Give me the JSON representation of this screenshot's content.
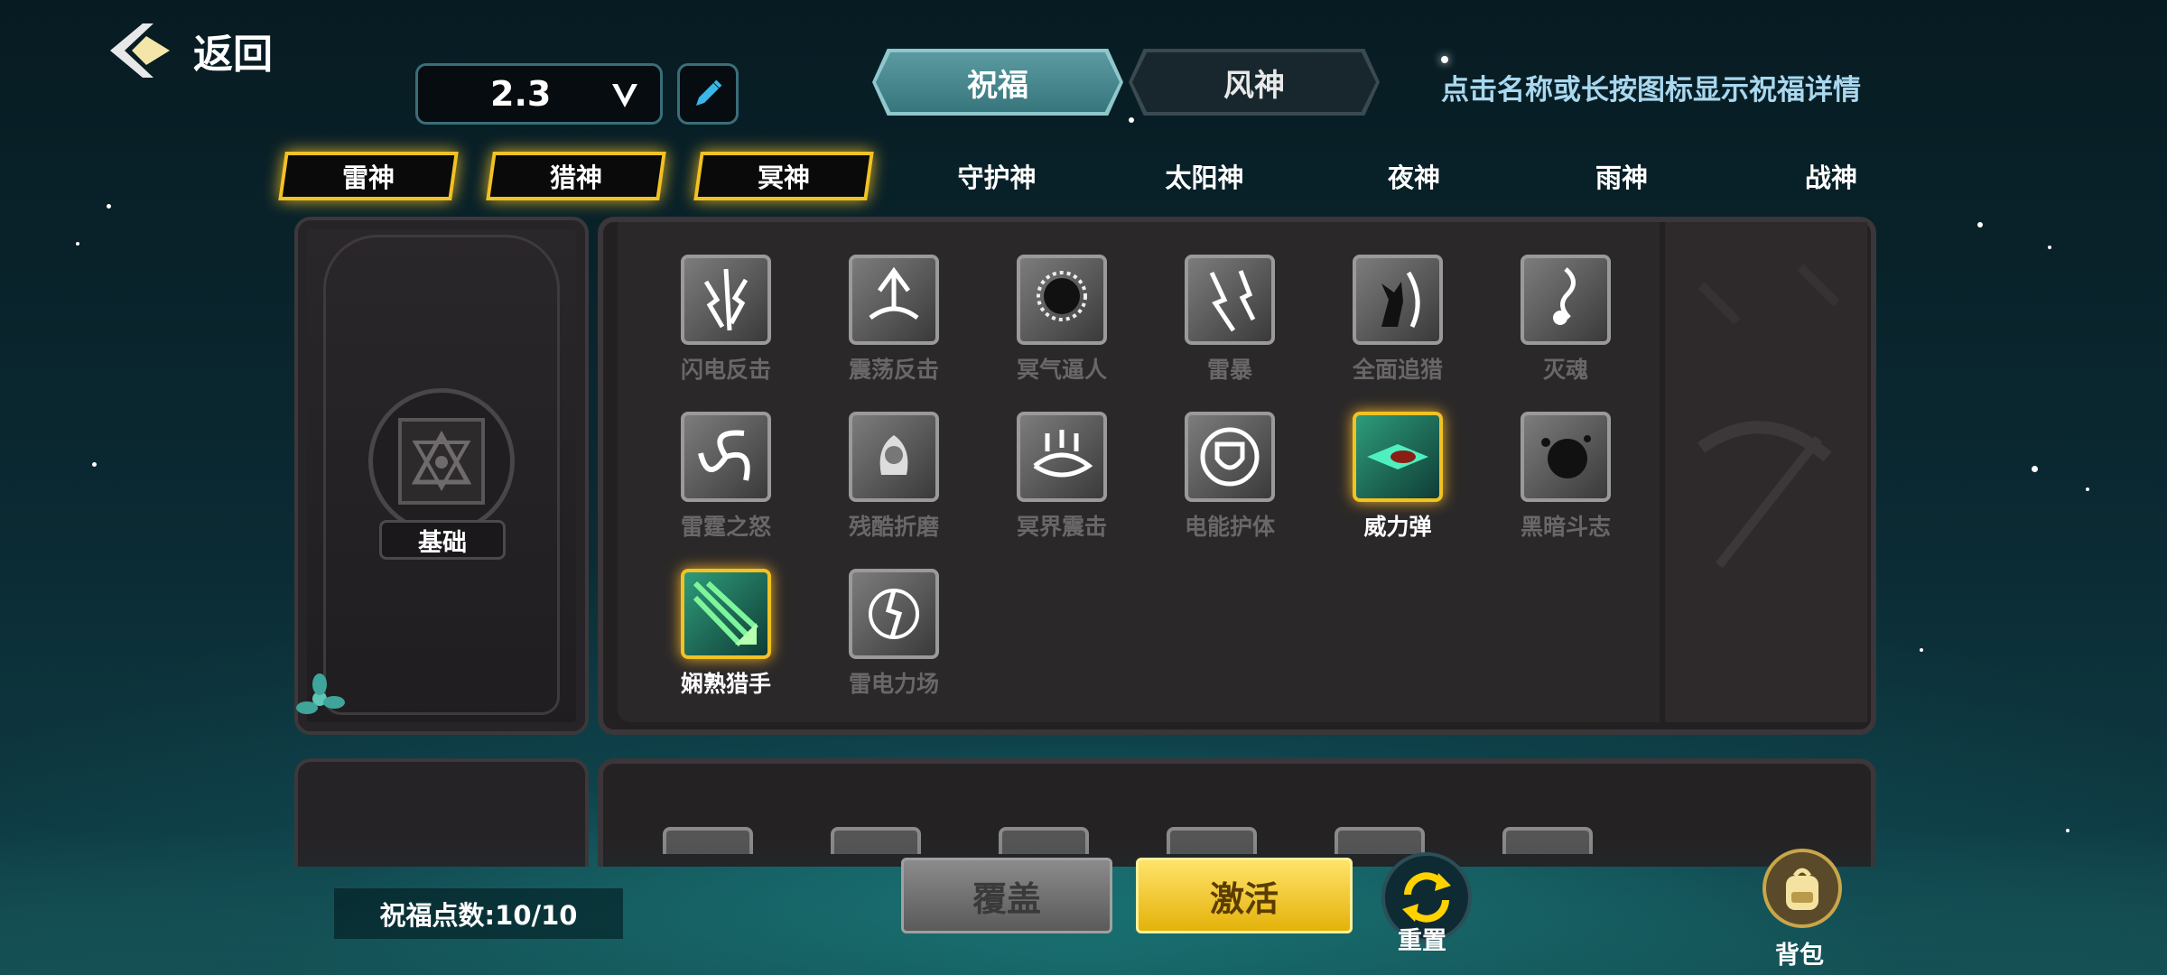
{
  "header": {
    "back_label": "返回",
    "version_value": "2.3",
    "hint_text": "点击名称或长按图标显示祝福详情"
  },
  "mode_tabs": [
    {
      "label": "祝福",
      "active": true
    },
    {
      "label": "风神",
      "active": false
    }
  ],
  "god_tabs": [
    {
      "label": "雷神",
      "selected": true
    },
    {
      "label": "猎神",
      "selected": true
    },
    {
      "label": "冥神",
      "selected": true
    },
    {
      "label": "守护神",
      "selected": false
    },
    {
      "label": "太阳神",
      "selected": false
    },
    {
      "label": "夜神",
      "selected": false
    },
    {
      "label": "雨神",
      "selected": false
    },
    {
      "label": "战神",
      "selected": false
    }
  ],
  "category_card": {
    "label": "基础"
  },
  "skills": [
    {
      "name": "闪电反击",
      "active": false
    },
    {
      "name": "震荡反击",
      "active": false
    },
    {
      "name": "冥气逼人",
      "active": false
    },
    {
      "name": "雷暴",
      "active": false
    },
    {
      "name": "全面追猎",
      "active": false
    },
    {
      "name": "灭魂",
      "active": false
    },
    {
      "name": "雷霆之怒",
      "active": false
    },
    {
      "name": "残酷折磨",
      "active": false
    },
    {
      "name": "冥界震击",
      "active": false
    },
    {
      "name": "电能护体",
      "active": false
    },
    {
      "name": "威力弹",
      "active": true
    },
    {
      "name": "黑暗斗志",
      "active": false
    },
    {
      "name": "娴熟猎手",
      "active": true
    },
    {
      "name": "雷电力场",
      "active": false
    }
  ],
  "footer": {
    "points_text": "祝福点数:10/10",
    "cover_label": "覆盖",
    "activate_label": "激活",
    "reset_label": "重置",
    "bag_label": "背包"
  },
  "colors": {
    "accent_gold": "#f2c224",
    "teal_tab": "#4a8a90",
    "hint_blue": "#a9d8ef"
  }
}
